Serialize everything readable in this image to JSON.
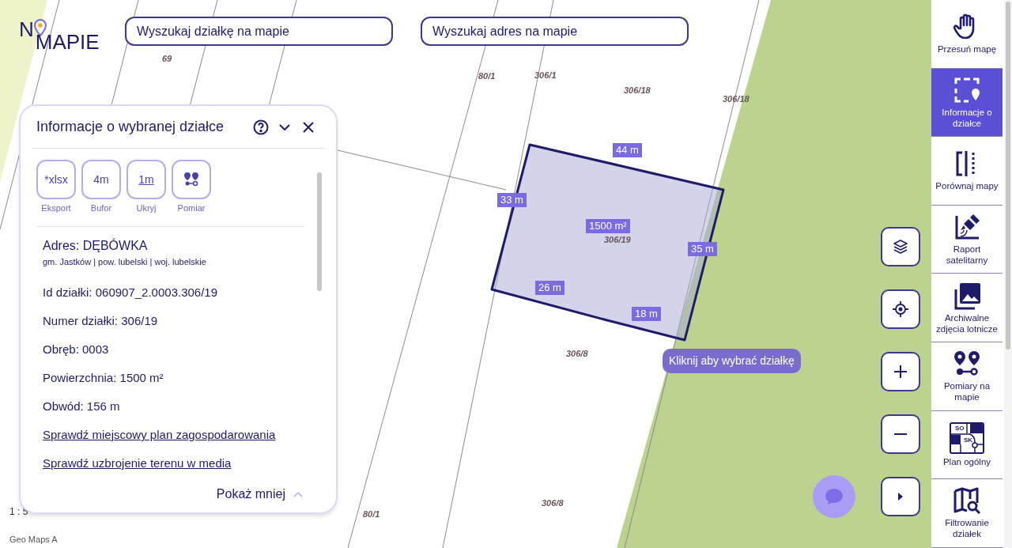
{
  "logo": {
    "first": "N",
    "second": "MAPIE"
  },
  "search_fields": [
    {
      "placeholder": "Wyszukaj działkę na mapie"
    },
    {
      "placeholder": "Wyszukaj adres na mapie"
    }
  ],
  "map": {
    "parcel_numbers": [
      "69",
      "80/1",
      "306/1",
      "306/18",
      "306/18",
      "306/19",
      "306/8",
      "306/8",
      "80/1"
    ],
    "measure_labels": [
      "44 m",
      "33 m",
      "1500 m²",
      "35 m",
      "26 m",
      "18 m"
    ],
    "tooltip": "Kliknij aby wybrać działkę",
    "scale": "1 : 5",
    "attribution": "Geo Maps A"
  },
  "info_panel": {
    "title": "Informacje o wybranej działce",
    "tools": [
      {
        "kind": "text",
        "glyph": "*xlsx",
        "label": "Eksport"
      },
      {
        "kind": "text",
        "glyph": "4m",
        "label": "Bufor"
      },
      {
        "kind": "ruler",
        "glyph": "1m",
        "label": "Ukryj"
      },
      {
        "kind": "pins",
        "label": "Pomiar"
      }
    ],
    "address": "Adres: DĘBÓWKA",
    "region": "gm. Jastków | pow. lubelski | woj. lubelskie",
    "fields": [
      "Id działki: 060907_2.0003.306/19",
      "Numer działki: 306/19",
      "Obręb: 0003",
      "Powierzchnia: 1500 m²",
      "Obwód: 156 m"
    ],
    "links": [
      "Sprawdź miejscowy plan zagospodarowania",
      "Sprawdź uzbrojenie terenu w media"
    ],
    "toggle": "Pokaż mniej"
  },
  "map_controls": [
    {
      "kind": "layers"
    },
    {
      "kind": "locate"
    },
    {
      "kind": "zoom-in"
    },
    {
      "kind": "zoom-out"
    },
    {
      "kind": "expand"
    }
  ],
  "sidebar": {
    "items": [
      {
        "kind": "hand",
        "label": "Przesuń mapę",
        "selected": false
      },
      {
        "kind": "select",
        "label": "Informacje o działce",
        "selected": true
      },
      {
        "kind": "compare",
        "label": "Porównaj mapy",
        "selected": false
      },
      {
        "kind": "satellite",
        "label": "Raport satelitarny",
        "selected": false
      },
      {
        "kind": "photos",
        "label": "Archiwalne zdjęcia lotnicze",
        "selected": false
      },
      {
        "kind": "pins",
        "label": "Pomiary na mapie",
        "selected": false
      },
      {
        "kind": "plan",
        "label": "Plan ogólny",
        "selected": false,
        "icon_texts": [
          "SO",
          "SK"
        ]
      },
      {
        "kind": "filter",
        "label": "Filtrowanie działek",
        "selected": false
      }
    ]
  }
}
